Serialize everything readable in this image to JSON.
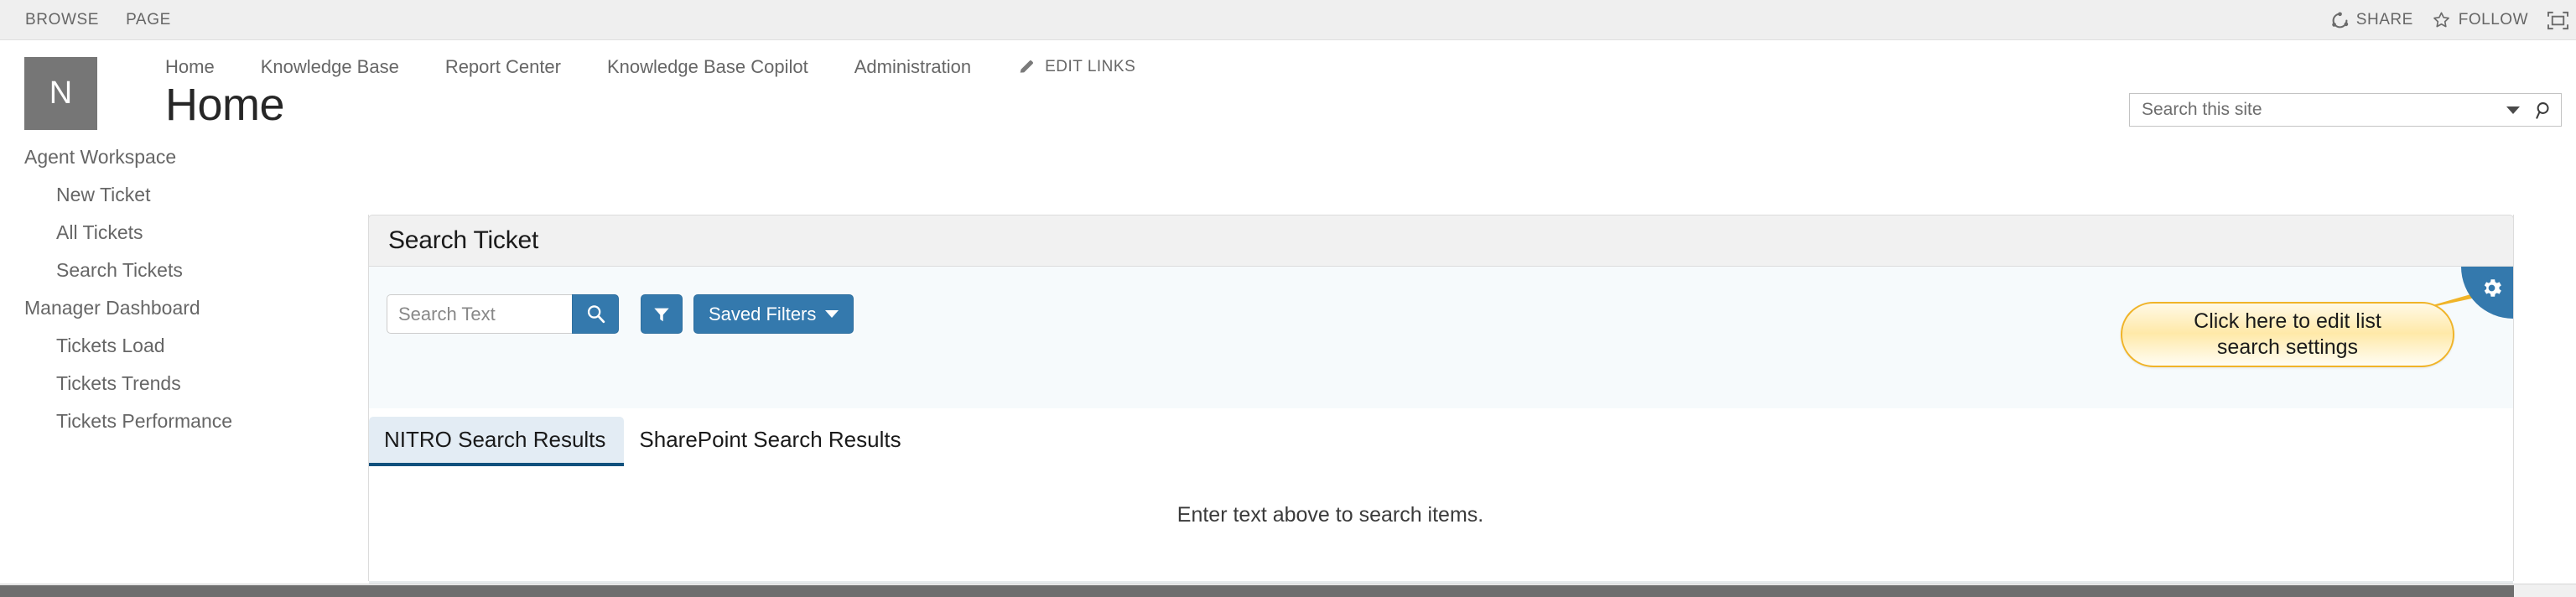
{
  "ribbon": {
    "tabs": [
      "BROWSE",
      "PAGE"
    ],
    "share_label": "SHARE",
    "follow_label": "FOLLOW",
    "focus_label": "focus-on-content"
  },
  "site": {
    "logo_letter": "N",
    "title": "Home",
    "nav": [
      "Home",
      "Knowledge Base",
      "Report Center",
      "Knowledge Base Copilot",
      "Administration"
    ],
    "edit_links_label": "EDIT LINKS"
  },
  "site_search": {
    "placeholder": "Search this site",
    "value": ""
  },
  "quicklaunch": {
    "groups": [
      {
        "header": "Agent Workspace",
        "items": [
          "New Ticket",
          "All Tickets",
          "Search Tickets"
        ]
      },
      {
        "header": "Manager Dashboard",
        "items": [
          "Tickets Load",
          "Tickets Trends",
          "Tickets Performance"
        ]
      }
    ]
  },
  "panel": {
    "title": "Search Ticket",
    "toolbar": {
      "search_placeholder": "Search Text",
      "search_value": "",
      "search_button_label": "search-icon",
      "filter_button_label": "filter-icon",
      "saved_filters_label": "Saved Filters"
    },
    "callout": {
      "line1": "Click here to edit list",
      "line2": "search settings"
    },
    "gear_label": "gear-icon",
    "tabs": [
      {
        "label": "NITRO Search Results",
        "active": true
      },
      {
        "label": "SharePoint Search Results",
        "active": false
      }
    ],
    "empty_message": "Enter text above to search items."
  },
  "colors": {
    "accent_blue": "#3479ad",
    "tab_active_underline": "#10507d",
    "tab_active_bg": "#e3ecf4",
    "callout_border": "#f0b429",
    "ribbon_bg": "#efefef",
    "logo_bg": "#767676",
    "toolbar_bg": "#f6fafc"
  }
}
